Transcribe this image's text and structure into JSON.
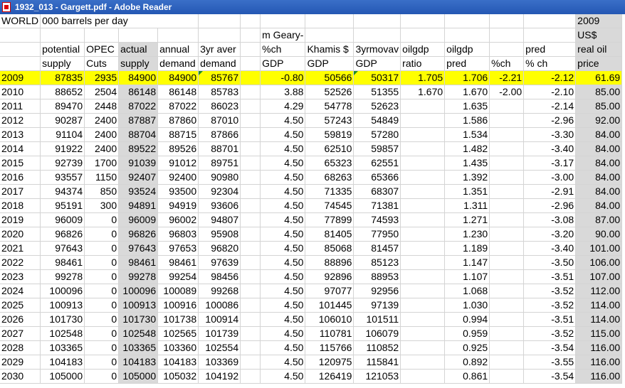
{
  "window": {
    "title": "1932_013 - Gargett.pdf - Adobe Reader",
    "icon": "pdf-icon"
  },
  "header_rows": [
    [
      "WORLD",
      "000 barrels per day",
      "",
      "",
      "",
      "",
      "",
      "",
      "",
      "",
      "",
      "",
      "",
      "",
      "2009"
    ],
    [
      "",
      "",
      "",
      "",
      "",
      "",
      "",
      "m Geary-",
      "",
      "",
      "",
      "",
      "",
      "",
      "US$"
    ],
    [
      "",
      "potential",
      "OPEC",
      "actual",
      "annual",
      "3yr aver",
      "",
      "%ch",
      "Khamis $",
      "3yrmovav",
      "oilgdp",
      "oilgdp",
      "",
      "pred",
      "real oil"
    ],
    [
      "",
      "supply",
      "Cuts",
      "supply",
      "demand",
      "demand",
      "",
      "GDP",
      "GDP",
      "GDP",
      "ratio",
      "pred",
      "%ch",
      "% ch",
      "price"
    ]
  ],
  "data_rows": [
    [
      "2009",
      "87835",
      "2935",
      "84900",
      "84900",
      "85767",
      "",
      "-0.80",
      "50566",
      "50317",
      "1.705",
      "1.706",
      "-2.21",
      "-2.12",
      "61.69"
    ],
    [
      "2010",
      "88652",
      "2504",
      "86148",
      "86148",
      "85783",
      "",
      "3.88",
      "52526",
      "51355",
      "1.670",
      "1.670",
      "-2.00",
      "-2.10",
      "85.00"
    ],
    [
      "2011",
      "89470",
      "2448",
      "87022",
      "87022",
      "86023",
      "",
      "4.29",
      "54778",
      "52623",
      "",
      "1.635",
      "",
      "-2.14",
      "85.00"
    ],
    [
      "2012",
      "90287",
      "2400",
      "87887",
      "87860",
      "87010",
      "",
      "4.50",
      "57243",
      "54849",
      "",
      "1.586",
      "",
      "-2.96",
      "92.00"
    ],
    [
      "2013",
      "91104",
      "2400",
      "88704",
      "88715",
      "87866",
      "",
      "4.50",
      "59819",
      "57280",
      "",
      "1.534",
      "",
      "-3.30",
      "84.00"
    ],
    [
      "2014",
      "91922",
      "2400",
      "89522",
      "89526",
      "88701",
      "",
      "4.50",
      "62510",
      "59857",
      "",
      "1.482",
      "",
      "-3.40",
      "84.00"
    ],
    [
      "2015",
      "92739",
      "1700",
      "91039",
      "91012",
      "89751",
      "",
      "4.50",
      "65323",
      "62551",
      "",
      "1.435",
      "",
      "-3.17",
      "84.00"
    ],
    [
      "2016",
      "93557",
      "1150",
      "92407",
      "92400",
      "90980",
      "",
      "4.50",
      "68263",
      "65366",
      "",
      "1.392",
      "",
      "-3.00",
      "84.00"
    ],
    [
      "2017",
      "94374",
      "850",
      "93524",
      "93500",
      "92304",
      "",
      "4.50",
      "71335",
      "68307",
      "",
      "1.351",
      "",
      "-2.91",
      "84.00"
    ],
    [
      "2018",
      "95191",
      "300",
      "94891",
      "94919",
      "93606",
      "",
      "4.50",
      "74545",
      "71381",
      "",
      "1.311",
      "",
      "-2.96",
      "84.00"
    ],
    [
      "2019",
      "96009",
      "0",
      "96009",
      "96002",
      "94807",
      "",
      "4.50",
      "77899",
      "74593",
      "",
      "1.271",
      "",
      "-3.08",
      "87.00"
    ],
    [
      "2020",
      "96826",
      "0",
      "96826",
      "96803",
      "95908",
      "",
      "4.50",
      "81405",
      "77950",
      "",
      "1.230",
      "",
      "-3.20",
      "90.00"
    ],
    [
      "2021",
      "97643",
      "0",
      "97643",
      "97653",
      "96820",
      "",
      "4.50",
      "85068",
      "81457",
      "",
      "1.189",
      "",
      "-3.40",
      "101.00"
    ],
    [
      "2022",
      "98461",
      "0",
      "98461",
      "98461",
      "97639",
      "",
      "4.50",
      "88896",
      "85123",
      "",
      "1.147",
      "",
      "-3.50",
      "106.00"
    ],
    [
      "2023",
      "99278",
      "0",
      "99278",
      "99254",
      "98456",
      "",
      "4.50",
      "92896",
      "88953",
      "",
      "1.107",
      "",
      "-3.51",
      "107.00"
    ],
    [
      "2024",
      "100096",
      "0",
      "100096",
      "100089",
      "99268",
      "",
      "4.50",
      "97077",
      "92956",
      "",
      "1.068",
      "",
      "-3.52",
      "112.00"
    ],
    [
      "2025",
      "100913",
      "0",
      "100913",
      "100916",
      "100086",
      "",
      "4.50",
      "101445",
      "97139",
      "",
      "1.030",
      "",
      "-3.52",
      "114.00"
    ],
    [
      "2026",
      "101730",
      "0",
      "101730",
      "101738",
      "100914",
      "",
      "4.50",
      "106010",
      "101511",
      "",
      "0.994",
      "",
      "-3.51",
      "114.00"
    ],
    [
      "2027",
      "102548",
      "0",
      "102548",
      "102565",
      "101739",
      "",
      "4.50",
      "110781",
      "106079",
      "",
      "0.959",
      "",
      "-3.52",
      "115.00"
    ],
    [
      "2028",
      "103365",
      "0",
      "103365",
      "103360",
      "102554",
      "",
      "4.50",
      "115766",
      "110852",
      "",
      "0.925",
      "",
      "-3.54",
      "116.00"
    ],
    [
      "2029",
      "104183",
      "0",
      "104183",
      "104183",
      "103369",
      "",
      "4.50",
      "120975",
      "115841",
      "",
      "0.892",
      "",
      "-3.55",
      "116.00"
    ],
    [
      "2030",
      "105000",
      "0",
      "105000",
      "105032",
      "104192",
      "",
      "4.50",
      "126419",
      "121053",
      "",
      "0.861",
      "",
      "-3.54",
      "116.00"
    ]
  ],
  "colors": {
    "highlight": "#ffff00",
    "shaded_column": "#d9d9d9",
    "titlebar": "#2457b3",
    "indicator": "#1e8c28"
  }
}
